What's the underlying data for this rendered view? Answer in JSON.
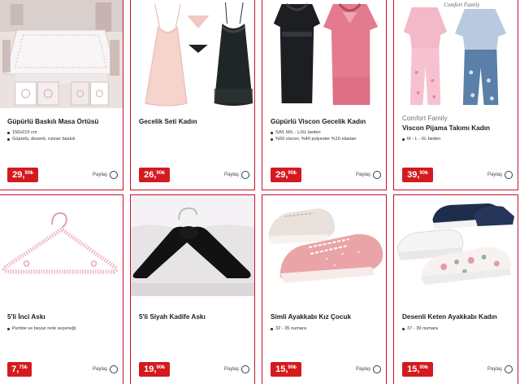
{
  "products": [
    {
      "brand": "",
      "title": "Güpürlü Baskılı Masa Örtüsü",
      "bullets": [
        "150x215 cm",
        "Güpürlü, desenli, runner baskılı"
      ],
      "price_main": "29,",
      "price_sup": "90₺",
      "share_label": "Paylaş",
      "image_icon": "tablecloth-image"
    },
    {
      "brand": "",
      "title": "Gecelik Seti Kadın",
      "bullets": [],
      "price_main": "26,",
      "price_sup": "90₺",
      "share_label": "Paylaş",
      "image_icon": "nightgown-set-image"
    },
    {
      "brand": "",
      "title": "Güpürlü Viscon Gecelik Kadın",
      "bullets": [
        "S/M, M/L - L/XL beden",
        "%50 viscon, %40 polyester %10 elastan"
      ],
      "price_main": "29,",
      "price_sup": "90₺",
      "share_label": "Paylaş",
      "image_icon": "viscose-nightgown-image"
    },
    {
      "brand": "Comfort Family",
      "title": "Viscon Pijama Takımı Kadın",
      "bullets": [
        "M - L - XL beden"
      ],
      "price_main": "39,",
      "price_sup": "90₺",
      "share_label": "Paylaş",
      "image_icon": "pajama-set-image",
      "image_logo_text": "Comfort Family"
    },
    {
      "brand": "",
      "title": "5'li İnci Askı",
      "bullets": [
        "Pembe ve beyaz renk seçeneği"
      ],
      "price_main": "7,",
      "price_sup": "75₺",
      "share_label": "Paylaş",
      "image_icon": "pearl-hanger-image"
    },
    {
      "brand": "",
      "title": "5'li Siyah Kadife Askı",
      "bullets": [],
      "price_main": "19,",
      "price_sup": "90₺",
      "share_label": "Paylaş",
      "image_icon": "velvet-hanger-image"
    },
    {
      "brand": "",
      "title": "Simli Ayakkabı Kız Çocuk",
      "bullets": [
        "32 - 35 numara"
      ],
      "price_main": "15,",
      "price_sup": "90₺",
      "share_label": "Paylaş",
      "image_icon": "glitter-sneakers-image"
    },
    {
      "brand": "",
      "title": "Desenli Keten Ayakkabı Kadın",
      "bullets": [
        "37 - 39 numara"
      ],
      "price_main": "15,",
      "price_sup": "90₺",
      "share_label": "Paylaş",
      "image_icon": "canvas-shoes-image"
    }
  ],
  "colors": {
    "card_border": "#c8102e",
    "price_badge": "#d41a1f",
    "share_circle": "#25415c"
  }
}
